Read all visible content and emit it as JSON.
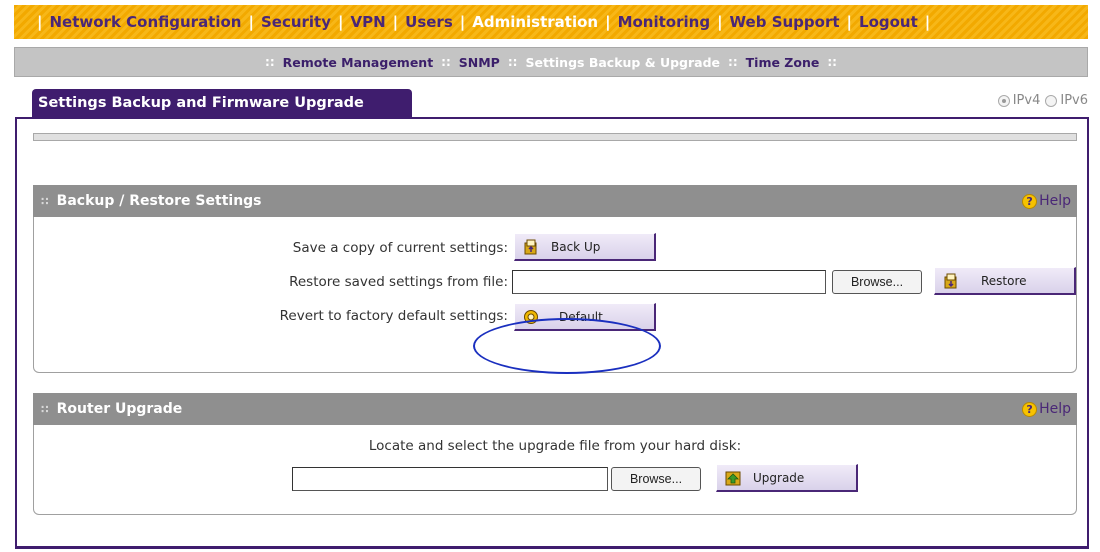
{
  "topnav": {
    "items": [
      {
        "label": "Network Configuration"
      },
      {
        "label": "Security"
      },
      {
        "label": "VPN"
      },
      {
        "label": "Users"
      },
      {
        "label": "Administration",
        "active": true
      },
      {
        "label": "Monitoring"
      },
      {
        "label": "Web Support"
      },
      {
        "label": "Logout"
      }
    ],
    "separator": "|"
  },
  "subnav": {
    "items": [
      {
        "label": "Remote Management"
      },
      {
        "label": "SNMP"
      },
      {
        "label": "Settings Backup & Upgrade",
        "active": true
      },
      {
        "label": "Time Zone"
      }
    ],
    "separator": "::"
  },
  "page": {
    "tab_title": "Settings Backup and Firmware Upgrade",
    "ip_options": [
      {
        "label": "IPv4",
        "checked": true
      },
      {
        "label": "IPv6",
        "checked": false
      }
    ]
  },
  "backup_section": {
    "title": "Backup / Restore Settings",
    "help_label": "Help",
    "save_label": "Save a copy of current settings:",
    "backup_button": "Back Up",
    "restore_label": "Restore saved settings from file:",
    "restore_file_value": "",
    "browse_button": "Browse...",
    "restore_button": "Restore",
    "revert_label": "Revert to factory default settings:",
    "default_button": "Default"
  },
  "upgrade_section": {
    "title": "Router Upgrade",
    "help_label": "Help",
    "instruction": "Locate and select the upgrade file from your hard disk:",
    "file_value": "",
    "browse_button": "Browse...",
    "upgrade_button": "Upgrade"
  },
  "icons": {
    "backup": "backup-icon",
    "restore": "restore-icon",
    "default": "default-icon",
    "upgrade": "upgrade-icon",
    "help": "help-icon",
    "grip": "grip-icon"
  },
  "colors": {
    "nav_orange": "#f2a900",
    "nav_text_purple": "#4a2777",
    "tab_purple": "#3f1d6e",
    "section_header_grey": "#8f8f8f",
    "highlight_blue": "#1a2fbf"
  }
}
